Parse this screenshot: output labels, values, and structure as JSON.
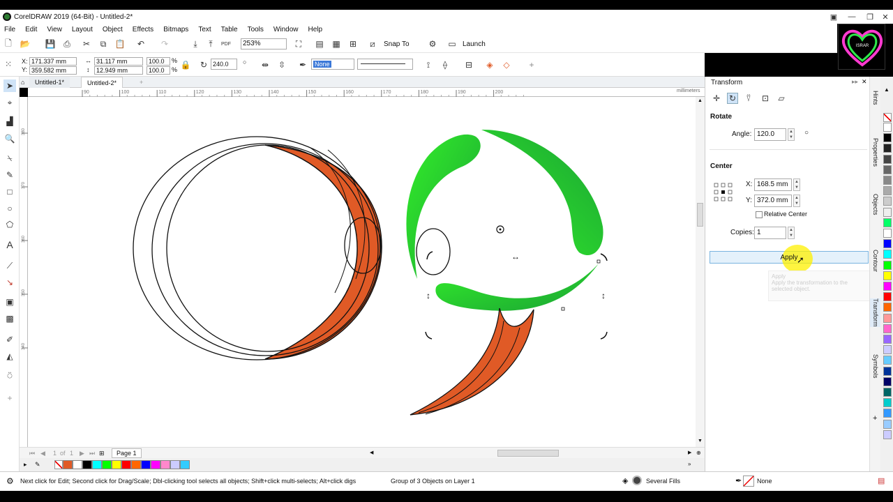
{
  "window": {
    "title": "CorelDRAW 2019 (64-Bit) - Untitled-2*"
  },
  "menu": [
    "File",
    "Edit",
    "View",
    "Layout",
    "Object",
    "Effects",
    "Bitmaps",
    "Text",
    "Table",
    "Tools",
    "Window",
    "Help"
  ],
  "toolbar": {
    "zoom": "253%",
    "snap_to": "Snap To",
    "launch": "Launch"
  },
  "propbar": {
    "x_label": "X:",
    "x_value": "171.337 mm",
    "y_label": "Y:",
    "y_value": "359.582 mm",
    "w_value": "31.117 mm",
    "h_value": "12.949 mm",
    "scale_w": "100.0",
    "scale_h": "100.0",
    "pct": "%",
    "rotation": "240.0",
    "outline_width": "None"
  },
  "tabs": [
    "Untitled-1*",
    "Untitled-2*"
  ],
  "ruler": {
    "h_ticks": [
      "90",
      "100",
      "110",
      "120",
      "130",
      "140",
      "150",
      "160",
      "170",
      "180",
      "190",
      "200"
    ],
    "unit": "millimeters",
    "v_ticks": [
      "380",
      "370",
      "360",
      "350",
      "340"
    ]
  },
  "page_nav": {
    "current": "1",
    "of": "of",
    "total": "1",
    "page_tab": "Page 1"
  },
  "docker": {
    "title": "Transform",
    "section_rotate": "Rotate",
    "angle_label": "Angle:",
    "angle_value": "120.0",
    "section_center": "Center",
    "cx_label": "X:",
    "cx_value": "168.5 mm",
    "cy_label": "Y:",
    "cy_value": "372.0 mm",
    "relative_center": "Relative Center",
    "copies_label": "Copies:",
    "copies_value": "1",
    "apply": "Apply",
    "tooltip_title": "Apply",
    "tooltip_body": "Apply the transformation to the selected object."
  },
  "side_tabs": [
    "Hints",
    "Properties",
    "Objects",
    "Contour",
    "Transform",
    "Symbols"
  ],
  "status": {
    "hint": "Next click for Edit; Second click for Drag/Scale; Dbl-clicking tool selects all objects; Shift+click multi-selects; Alt+click digs",
    "selection": "Group of 3 Objects on Layer 1",
    "fill": "Several Fills",
    "outline": "None"
  },
  "colors": {
    "orange": "#e05a26",
    "green_light": "#33ee2a",
    "green_dark": "#1aa334",
    "palette": [
      "#e05a26",
      "#ffffff",
      "#000000",
      "#00ffff",
      "#00ff00",
      "#ffff00",
      "#ff0000",
      "#ff6600",
      "#0000ff",
      "#ff00ff",
      "#ff88cc",
      "#ccccff",
      "#33ccff"
    ],
    "side_palette": [
      "#ffffff",
      "#000000",
      "#222222",
      "#444444",
      "#666666",
      "#888888",
      "#aaaaaa",
      "#cccccc",
      "#eeeeee",
      "#00ff66",
      "#ffffff",
      "#0000ff",
      "#00ffff",
      "#00ff00",
      "#ffff00",
      "#ff00ff",
      "#ff0000",
      "#ff6600",
      "#ff9999",
      "#ff66cc",
      "#9966ff",
      "#ccccff",
      "#66ccff",
      "#003399",
      "#000066",
      "#006666",
      "#00cccc",
      "#3399ff",
      "#99ccff",
      "#ccccff"
    ]
  }
}
